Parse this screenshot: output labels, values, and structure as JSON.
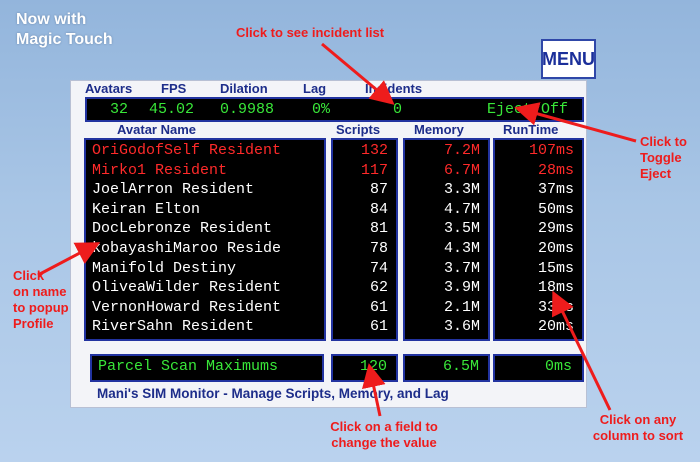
{
  "annotations": {
    "title_line1": "Now with",
    "title_line2": "Magic Touch",
    "incident": "Click to see incident list",
    "eject_line1": "Click to",
    "eject_line2": "Toggle",
    "eject_line3": "Eject",
    "name_line1": "Click",
    "name_line2": "on name",
    "name_line3": "to popup",
    "name_line4": "Profile",
    "field_line1": "Click on a field to",
    "field_line2": "change the value",
    "sort_line1": "Click on any",
    "sort_line2": "column to sort"
  },
  "menu_label": "MENU",
  "stats_header": {
    "avatars": "Avatars",
    "fps": "FPS",
    "dilation": "Dilation",
    "lag": "Lag",
    "incidents": "Incidents"
  },
  "stats": {
    "avatars": "32",
    "fps": "45.02",
    "dilation": "0.9988",
    "lag": "0%",
    "incidents": "0",
    "eject": "Eject Off"
  },
  "columns": {
    "name": "Avatar Name",
    "scripts": "Scripts",
    "memory": "Memory",
    "runtime": "RunTime"
  },
  "rows": [
    {
      "name": "OriGodofSelf Resident",
      "scripts": "132",
      "memory": "7.2M",
      "runtime": "107ms"
    },
    {
      "name": "Mirko1 Resident",
      "scripts": "117",
      "memory": "6.7M",
      "runtime": "28ms"
    },
    {
      "name": "JoelArron Resident",
      "scripts": "87",
      "memory": "3.3M",
      "runtime": "37ms"
    },
    {
      "name": "Keiran Elton",
      "scripts": "84",
      "memory": "4.7M",
      "runtime": "50ms"
    },
    {
      "name": "DocLebronze Resident",
      "scripts": "81",
      "memory": "3.5M",
      "runtime": "29ms"
    },
    {
      "name": "kobayashiMaroo Reside",
      "scripts": "78",
      "memory": "4.3M",
      "runtime": "20ms"
    },
    {
      "name": "Manifold Destiny",
      "scripts": "74",
      "memory": "3.7M",
      "runtime": "15ms"
    },
    {
      "name": "OliveaWilder Resident",
      "scripts": "62",
      "memory": "3.9M",
      "runtime": "18ms"
    },
    {
      "name": "VernonHoward Resident",
      "scripts": "61",
      "memory": "2.1M",
      "runtime": "33ms"
    },
    {
      "name": "RiverSahn Resident",
      "scripts": "61",
      "memory": "3.6M",
      "runtime": "20ms"
    }
  ],
  "maximums": {
    "label": "Parcel Scan Maximums",
    "scripts": "120",
    "memory": "6.5M",
    "runtime": "0ms"
  },
  "footer_title": "Mani's SIM Monitor - Manage Scripts, Memory, and Lag",
  "colors": {
    "highlight_row": "#ff2a2a",
    "normal_row": "#ffffff",
    "stat_text": "#39e739",
    "header_text": "#1d2d8a",
    "annotation": "#ee1c1c"
  }
}
